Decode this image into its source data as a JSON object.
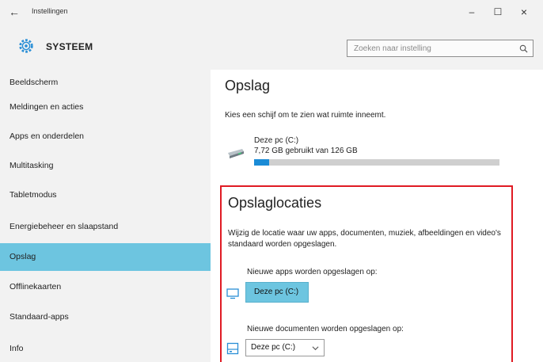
{
  "window": {
    "title": "Instellingen",
    "back_glyph": "←",
    "min_glyph": "–",
    "max_glyph": "☐",
    "close_glyph": "×"
  },
  "header": {
    "section": "SYSTEEM",
    "search_placeholder": "Zoeken naar instelling",
    "icons": {
      "section": "gear-icon",
      "search": "search-icon"
    }
  },
  "sidebar": {
    "items": [
      {
        "label": "Beeldscherm",
        "active": false
      },
      {
        "label": "Meldingen en acties",
        "active": false
      },
      {
        "label": "Apps en onderdelen",
        "active": false
      },
      {
        "label": "Multitasking",
        "active": false
      },
      {
        "label": "Tabletmodus",
        "active": false
      },
      {
        "label": "Energiebeheer en slaapstand",
        "active": false
      },
      {
        "label": "Opslag",
        "active": true
      },
      {
        "label": "Offlinekaarten",
        "active": false
      },
      {
        "label": "Standaard-apps",
        "active": false
      },
      {
        "label": "Info",
        "active": false
      }
    ]
  },
  "main": {
    "title": "Opslag",
    "intro": "Kies een schijf om te zien wat ruimte inneemt.",
    "drive": {
      "name": "Deze pc (C:)",
      "usage": "7,72 GB gebruikt van 126 GB",
      "used_fraction": 0.061,
      "icon": "drive-icon"
    },
    "locations": {
      "title": "Opslaglocaties",
      "description": "Wijzig de locatie waar uw apps, documenten, muziek, afbeeldingen en video's standaard worden opgeslagen.",
      "apps_label": "Nieuwe apps worden opgeslagen op:",
      "apps_value": "Deze pc (C:)",
      "docs_label": "Nieuwe documenten worden opgeslagen op:",
      "docs_value": "Deze pc (C:)"
    }
  },
  "colors": {
    "accent": "#6dc5e0",
    "usage_fill": "#1a8bd6",
    "highlight_border": "#e01b24"
  }
}
